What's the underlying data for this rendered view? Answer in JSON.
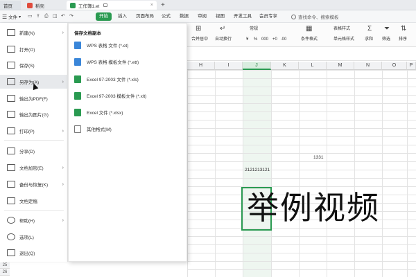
{
  "titlebar": {
    "tabs": [
      {
        "label": "首页",
        "color": "#3a86d9"
      },
      {
        "label": "稻壳",
        "color": "#e04b3c"
      },
      {
        "label": "工作簿1.et",
        "color": "#2a9a51"
      }
    ],
    "new_tab": "+"
  },
  "menubar": {
    "file_label": "文件",
    "tabs": [
      "开始",
      "插入",
      "页面布局",
      "公式",
      "数据",
      "审阅",
      "视图",
      "开发工具",
      "会员专享"
    ],
    "search_placeholder": "查找命令、搜索模板"
  },
  "ribbon": {
    "labels": [
      "合并居中",
      "自动换行",
      "常规",
      "条件格式",
      "表格样式",
      "单元格样式",
      "求和",
      "筛选",
      "排序"
    ],
    "glyphs": [
      "%",
      "000",
      "+0",
      ".00"
    ]
  },
  "columns": [
    "H",
    "I",
    "J",
    "K",
    "L",
    "M",
    "N",
    "O",
    "P"
  ],
  "rows_bottom": [
    "25",
    "26"
  ],
  "cells": {
    "l_value": "1331",
    "j_value": "2121213121",
    "big_text": "举例视频"
  },
  "file_menu": {
    "items": [
      {
        "label": "新建(N)",
        "arrow": true
      },
      {
        "label": "打开(O)",
        "arrow": false
      },
      {
        "label": "保存(S)",
        "arrow": false
      },
      {
        "label": "另存为(A)",
        "arrow": true
      },
      {
        "label": "输出为PDF(F)",
        "arrow": false
      },
      {
        "label": "输出为图片(G)",
        "arrow": false
      },
      {
        "label": "打印(P)",
        "arrow": true
      },
      {
        "label": "分享(D)",
        "arrow": false
      },
      {
        "label": "文档加密(E)",
        "arrow": true
      },
      {
        "label": "备份与恢复(K)",
        "arrow": true
      },
      {
        "label": "文档定稿",
        "arrow": false
      },
      {
        "label": "帮助(H)",
        "arrow": true
      },
      {
        "label": "选项(L)",
        "arrow": false
      },
      {
        "label": "退出(Q)",
        "arrow": false
      }
    ]
  },
  "save_as": {
    "title": "保存文档副本",
    "items": [
      {
        "label": "WPS 表格 文件 (*.et)",
        "kind": "wps"
      },
      {
        "label": "WPS 表格 模板文件 (*.ett)",
        "kind": "wps"
      },
      {
        "label": "Excel 97-2003 文件 (*.xls)",
        "kind": "xls"
      },
      {
        "label": "Excel 97-2003 模板文件 (*.xlt)",
        "kind": "xls"
      },
      {
        "label": "Excel 文件 (*.xlsx)",
        "kind": "xls"
      },
      {
        "label": "其他格式(M)",
        "kind": "other"
      }
    ]
  },
  "colors": {
    "accent": "#2a9a51",
    "wps_blue": "#3a86d9"
  }
}
